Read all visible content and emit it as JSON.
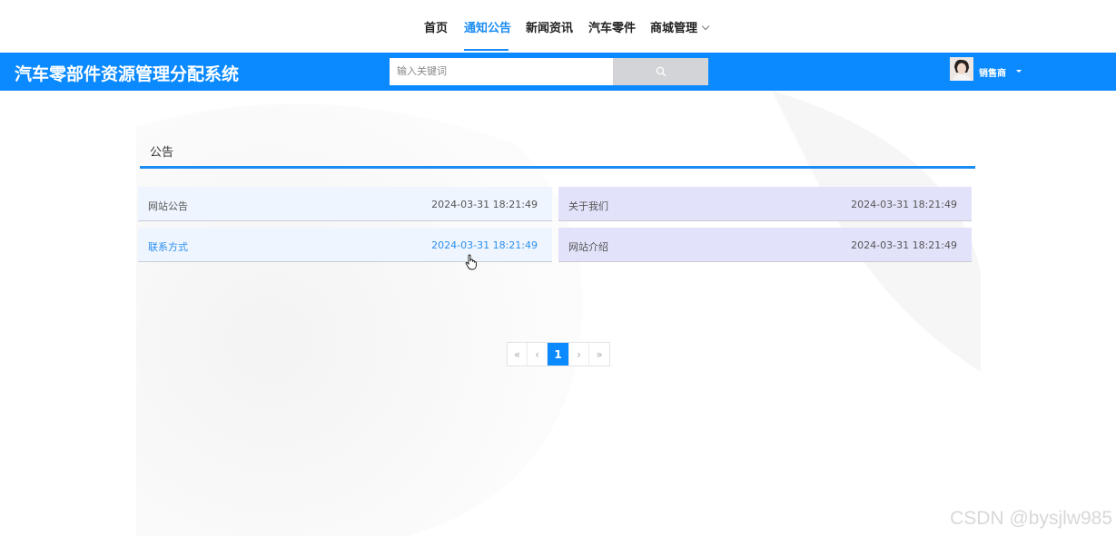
{
  "topnav": {
    "items": [
      {
        "label": "首页"
      },
      {
        "label": "通知公告"
      },
      {
        "label": "新闻资讯"
      },
      {
        "label": "汽车零件"
      },
      {
        "label": "商城管理"
      }
    ]
  },
  "header": {
    "logo": "汽车零部件资源管理分配系统",
    "search_placeholder": "输入关键词",
    "username": "销售商"
  },
  "section": {
    "title": "公告"
  },
  "notices": [
    {
      "title": "网站公告",
      "date": "2024-03-31 18:21:49"
    },
    {
      "title": "关于我们",
      "date": "2024-03-31 18:21:49"
    },
    {
      "title": "联系方式",
      "date": "2024-03-31 18:21:49"
    },
    {
      "title": "网站介绍",
      "date": "2024-03-31 18:21:49"
    }
  ],
  "pagination": {
    "first": "«",
    "prev": "‹",
    "current": "1",
    "next": "›",
    "last": "»"
  },
  "watermark": "CSDN @bysjlw985",
  "colors": {
    "accent": "#0b8aff",
    "active_nav": "#1a8cf3"
  }
}
